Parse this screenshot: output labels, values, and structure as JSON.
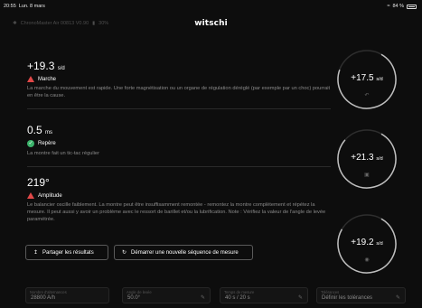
{
  "status": {
    "time": "20:55",
    "date": "Lun. 8 mars",
    "battery": "84 %"
  },
  "header": {
    "device": "ChronoMaster Air 00813 V0.90",
    "device_battery": "30%",
    "logo": "witschi"
  },
  "rate": {
    "value": "+19.3",
    "unit": "s/d",
    "label": "Marche",
    "description": "La marche du mouvement est rapide. Une forte magnétisation ou un organe de régulation déréglé (par exemple par un choc) pourrait en être la cause."
  },
  "beat": {
    "value": "0.5",
    "unit": "ms",
    "label": "Repère",
    "description": "La montre fait un tic-tac régulier"
  },
  "amplitude": {
    "value": "219°",
    "label": "Amplitude",
    "description": "Le balancier oscille faiblement. La montre peut être insuffisamment remontée - remontez la montre complètement et répétez la mesure. Il peut aussi y avoir un problème avec le ressort de barillet et/ou la lubrification. Note : Vérifiez la valeur de l'angle de levée paramétrée."
  },
  "gauges": [
    {
      "value": "+17.5",
      "unit": "s/d",
      "icon": "clockwise-arrow-icon",
      "level": 0.72
    },
    {
      "value": "+21.3",
      "unit": "s/d",
      "icon": "watch-face-icon",
      "level": 0.78
    },
    {
      "value": "+19.2",
      "unit": "s/d",
      "icon": "watch-crown-icon",
      "level": 0.75
    }
  ],
  "buttons": {
    "share": "Partager les résultats",
    "restart": "Démarrer une nouvelle séquence de mesure"
  },
  "fields": [
    {
      "label": "Nombre d'alternances",
      "value": "28800 A/h"
    },
    {
      "label": "Angle de levée",
      "value": "50.0°"
    },
    {
      "label": "Temps de mesure",
      "value": "40 s / 20 s"
    },
    {
      "label": "Tolérances",
      "value": "Définir les tolérances"
    }
  ],
  "colors": {
    "background": "#0d0d0d",
    "warning": "#e04848",
    "ok": "#3bb36b",
    "gauge_ring": "#bfbfbf"
  }
}
